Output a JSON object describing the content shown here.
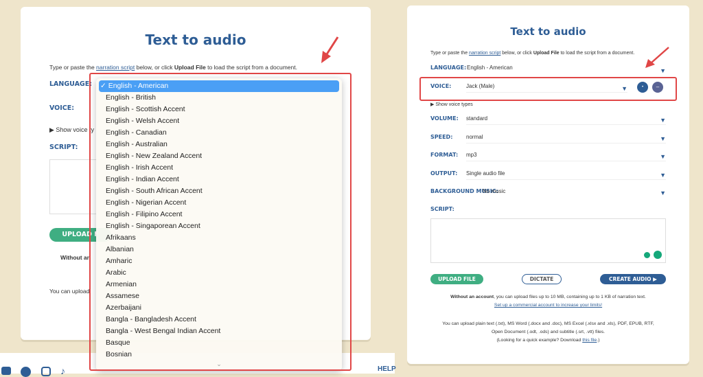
{
  "left": {
    "title": "Text to audio",
    "intro_pre": "Type or paste the ",
    "intro_link": "narration script",
    "intro_mid": " below, or click ",
    "intro_bold": "Upload File",
    "intro_post": " to load the script from a document.",
    "language_label": "LANGUAGE:",
    "voice_label": "VOICE:",
    "show_voice_types": "▶ Show voice ty",
    "script_label": "SCRIPT:",
    "upload_label": "UPLOAD F",
    "without_text": "Without an",
    "you_can_text": "You can upload",
    "language_options": [
      "English - American",
      "English - British",
      "English - Scottish Accent",
      "English - Welsh Accent",
      "English - Canadian",
      "English - Australian",
      "English - New Zealand Accent",
      "English - Irish Accent",
      "English - Indian Accent",
      "English - South African Accent",
      "English - Nigerian Accent",
      "English - Filipino Accent",
      "English - Singaporean Accent",
      "Afrikaans",
      "Albanian",
      "Amharic",
      "Arabic",
      "Armenian",
      "Assamese",
      "Azerbaijani",
      "Bangla - Bangladesh Accent",
      "Bangla - West Bengal Indian Accent",
      "Basque",
      "Bosnian"
    ],
    "selected_option": "English - American",
    "footer_help": "HELP"
  },
  "right": {
    "title": "Text to audio",
    "intro_pre": "Type or paste the ",
    "intro_link": "narration script",
    "intro_mid": " below, or click ",
    "intro_bold": "Upload File",
    "intro_post": " to load the script from a document.",
    "language": {
      "label": "LANGUAGE:",
      "value": "English - American"
    },
    "voice": {
      "label": "VOICE:",
      "value": "Jack (Male)"
    },
    "show_voice_types": "▶ Show voice types",
    "fields": [
      {
        "label": "VOLUME:",
        "value": "standard"
      },
      {
        "label": "SPEED:",
        "value": "normal"
      },
      {
        "label": "FORMAT:",
        "value": "mp3"
      },
      {
        "label": "OUTPUT:",
        "value": "Single audio file"
      },
      {
        "label": "BACKGROUND MUSIC:",
        "value": "No music"
      }
    ],
    "script_label": "SCRIPT:",
    "upload": "UPLOAD FILE",
    "dictate": "DICTATE",
    "create": "CREATE AUDIO ▶",
    "limit_bold": "Without an account",
    "limit_text": ", you can upload files up to 10 MB, containing up to 1 KB of narration text.",
    "limit_link": "Set up a commercial account to increase your limits!",
    "formats1": "You can upload plain text (.txt), MS Word (.docx and .doc), MS Excel (.xlsx and .xls), PDF, EPUB, RTF,",
    "formats2": "Open Document (.odt, .ods) and subtitle (.srt, .vtt) files.",
    "example_pre": "(Looking for a quick example? Download ",
    "example_link": "this file",
    "example_post": ".)"
  },
  "colors": {
    "brand": "#2e5d95",
    "green": "#3fae82",
    "highlight": "#e04646",
    "background": "#efe5cb"
  }
}
